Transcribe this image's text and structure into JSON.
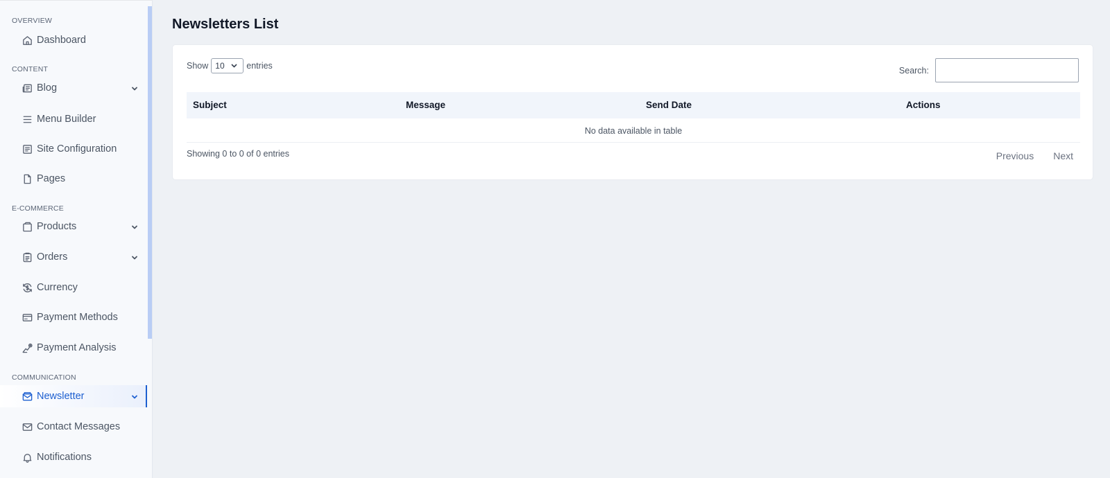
{
  "sidebar": {
    "sections": {
      "overview": "OVERVIEW",
      "content": "CONTENT",
      "ecommerce": "E-COMMERCE",
      "communication": "COMMUNICATION"
    },
    "items": {
      "dashboard": {
        "label": "Dashboard",
        "icon": "home-icon"
      },
      "blog": {
        "label": "Blog",
        "icon": "newspaper-icon"
      },
      "menu_builder": {
        "label": "Menu Builder",
        "icon": "menu-icon"
      },
      "site_configuration": {
        "label": "Site Configuration",
        "icon": "document-list-icon"
      },
      "pages": {
        "label": "Pages",
        "icon": "file-icon"
      },
      "products": {
        "label": "Products",
        "icon": "box-icon"
      },
      "orders": {
        "label": "Orders",
        "icon": "clipboard-icon"
      },
      "currency": {
        "label": "Currency",
        "icon": "currency-exchange-icon"
      },
      "payment_methods": {
        "label": "Payment Methods",
        "icon": "credit-card-icon"
      },
      "payment_analysis": {
        "label": "Payment Analysis",
        "icon": "chart-line-icon"
      },
      "newsletter": {
        "label": "Newsletter",
        "icon": "mail-open-icon"
      },
      "contact_messages": {
        "label": "Contact Messages",
        "icon": "envelope-icon"
      },
      "notifications": {
        "label": "Notifications",
        "icon": "bell-icon"
      }
    },
    "active_item": "Newsletter",
    "accent_color": "#1d5fd0"
  },
  "main": {
    "title": "Newsletters List",
    "length": {
      "show_label": "Show",
      "value": "10",
      "entries_label": "entries"
    },
    "search": {
      "label": "Search:",
      "value": ""
    },
    "table": {
      "columns": [
        "Subject",
        "Message",
        "Send Date",
        "Actions"
      ],
      "rows": [],
      "empty_message": "No data available in table"
    },
    "info": "Showing 0 to 0 of 0 entries",
    "pagination": {
      "previous": "Previous",
      "next": "Next"
    }
  }
}
